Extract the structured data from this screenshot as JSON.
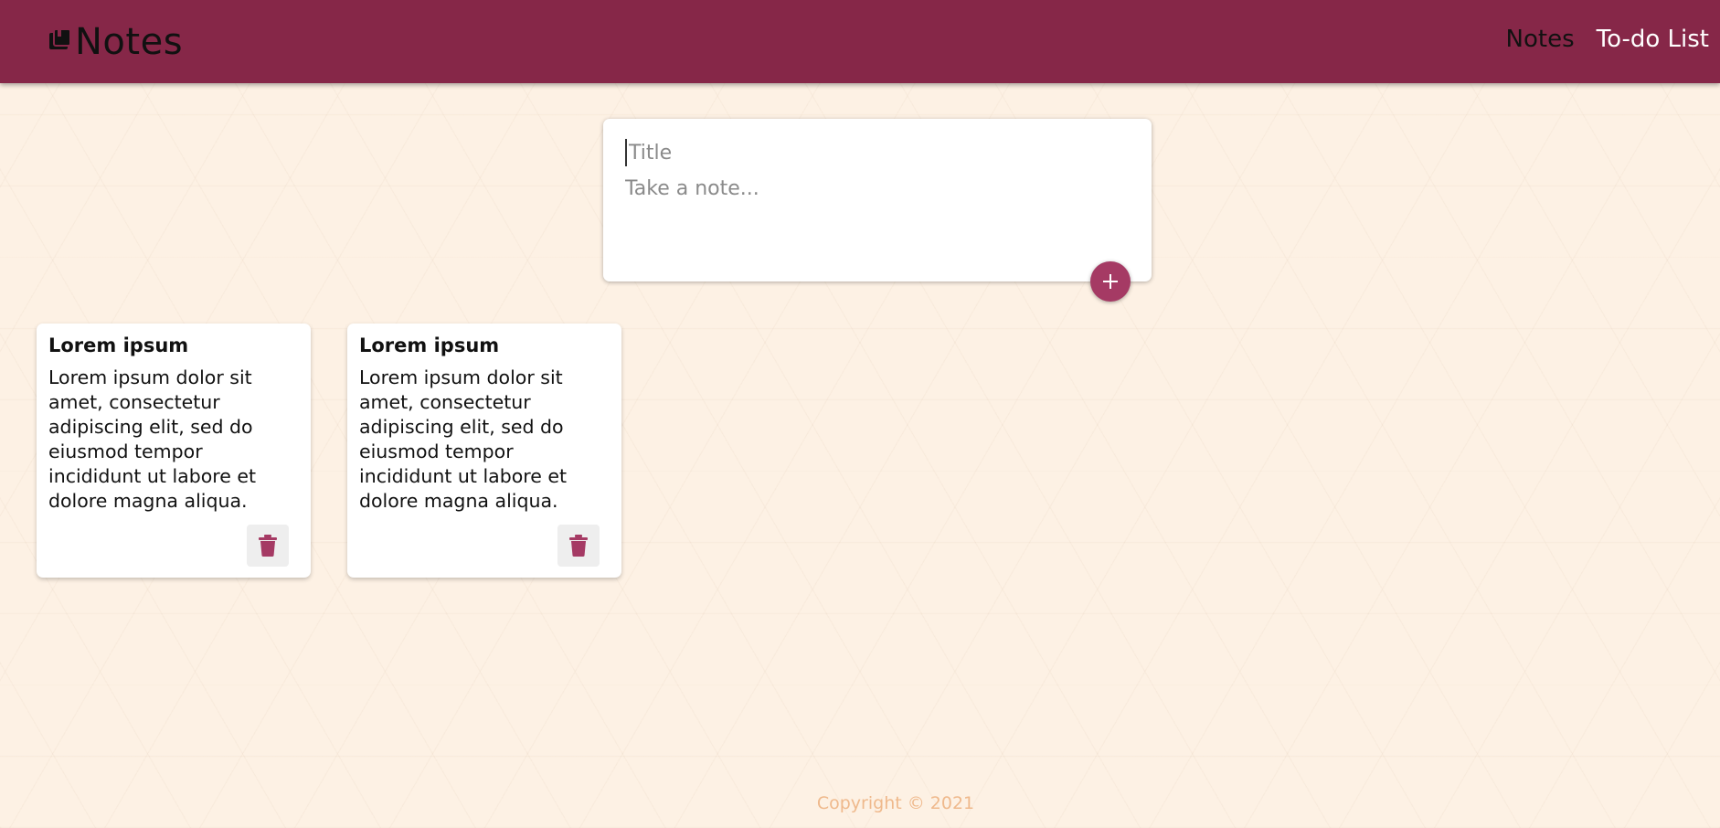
{
  "header": {
    "brand_title": "Notes",
    "nav": [
      {
        "label": "Notes"
      },
      {
        "label": "To-do List"
      }
    ],
    "brand_color": "#862748"
  },
  "create_note": {
    "title_placeholder": "Title",
    "content_placeholder": "Take a note...",
    "add_icon": "plus-icon",
    "accent_color": "#a53a64"
  },
  "notes": [
    {
      "title": "Lorem ipsum",
      "content": "Lorem ipsum dolor sit amet, consectetur adipiscing elit, sed do eiusmod tempor incididunt ut labore et dolore magna aliqua.",
      "delete_icon": "trash-icon"
    },
    {
      "title": "Lorem ipsum",
      "content": "Lorem ipsum dolor sit amet, consectetur adipiscing elit, sed do eiusmod tempor incididunt ut labore et dolore magna aliqua.",
      "delete_icon": "trash-icon"
    }
  ],
  "footer": {
    "text": "Copyright © 2021"
  }
}
